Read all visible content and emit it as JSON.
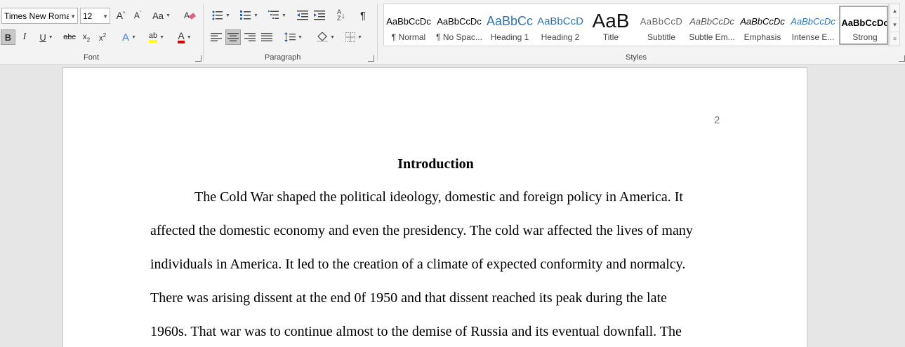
{
  "font": {
    "name": "Times New Roma",
    "size": "12",
    "group_label": "Font"
  },
  "paragraph": {
    "group_label": "Paragraph"
  },
  "styles": {
    "group_label": "Styles",
    "items": [
      {
        "preview": "AaBbCcDc",
        "label": "¶ Normal"
      },
      {
        "preview": "AaBbCcDc",
        "label": "¶ No Spac..."
      },
      {
        "preview": "AaBbCc",
        "label": "Heading 1"
      },
      {
        "preview": "AaBbCcD",
        "label": "Heading 2"
      },
      {
        "preview": "AaB",
        "label": "Title"
      },
      {
        "preview": "AaBbCcD",
        "label": "Subtitle"
      },
      {
        "preview": "AaBbCcDc",
        "label": "Subtle Em..."
      },
      {
        "preview": "AaBbCcDc",
        "label": "Emphasis"
      },
      {
        "preview": "AaBbCcDc",
        "label": "Intense E..."
      },
      {
        "preview": "AaBbCcDc",
        "label": "Strong"
      }
    ]
  },
  "document": {
    "page_number": "2",
    "heading": "Introduction",
    "lines": [
      "The Cold War shaped the political ideology, domestic and foreign policy in America. It",
      "affected the domestic economy and even the presidency. The cold war affected the lives of many",
      "individuals in America. It led to the creation of a climate of expected conformity and normalcy.",
      "There was arising dissent at the end 0f 1950 and that dissent reached its peak during the late",
      "1960s. That war was to continue almost to the demise of Russia and its eventual downfall. The"
    ]
  },
  "colors": {
    "heading_blue": "#2e74b5",
    "highlight_yellow": "#ffff00",
    "font_color_red": "#e00000"
  }
}
